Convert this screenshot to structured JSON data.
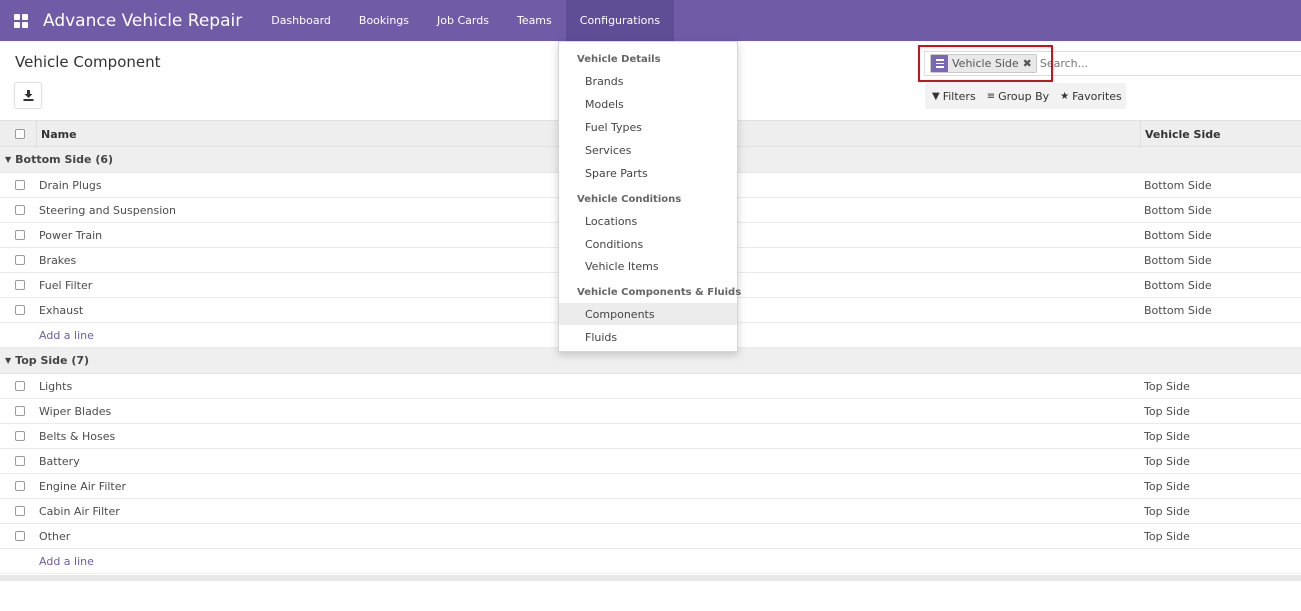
{
  "nav": {
    "app_title": "Advance Vehicle Repair",
    "menu": [
      "Dashboard",
      "Bookings",
      "Job Cards",
      "Teams",
      "Configurations"
    ]
  },
  "page": {
    "title": "Vehicle Component"
  },
  "search": {
    "facet_label": "Vehicle Side",
    "placeholder": "Search...",
    "filters_label": "Filters",
    "group_by_label": "Group By",
    "favorites_label": "Favorites"
  },
  "list": {
    "col_name": "Name",
    "col_side": "Vehicle Side",
    "add_line": "Add a line",
    "groups": [
      {
        "label": "Bottom Side (6)",
        "rows": [
          {
            "name": "Drain Plugs",
            "side": "Bottom Side"
          },
          {
            "name": "Steering and Suspension",
            "side": "Bottom Side"
          },
          {
            "name": "Power Train",
            "side": "Bottom Side"
          },
          {
            "name": "Brakes",
            "side": "Bottom Side"
          },
          {
            "name": "Fuel Filter",
            "side": "Bottom Side"
          },
          {
            "name": "Exhaust",
            "side": "Bottom Side"
          }
        ]
      },
      {
        "label": "Top Side (7)",
        "rows": [
          {
            "name": "Lights",
            "side": "Top Side"
          },
          {
            "name": "Wiper Blades",
            "side": "Top Side"
          },
          {
            "name": "Belts & Hoses",
            "side": "Top Side"
          },
          {
            "name": "Battery",
            "side": "Top Side"
          },
          {
            "name": "Engine Air Filter",
            "side": "Top Side"
          },
          {
            "name": "Cabin Air Filter",
            "side": "Top Side"
          },
          {
            "name": "Other",
            "side": "Top Side"
          }
        ]
      }
    ]
  },
  "dropdown": {
    "section_details": "Vehicle Details",
    "details_items": [
      "Brands",
      "Models",
      "Fuel Types",
      "Services",
      "Spare Parts"
    ],
    "section_conditions": "Vehicle Conditions",
    "conditions_items": [
      "Locations",
      "Conditions",
      "Vehicle Items"
    ],
    "section_components": "Vehicle Components & Fluids",
    "components_items": [
      "Components",
      "Fluids"
    ]
  },
  "colors": {
    "brand": "#6f5ba6",
    "highlight": "#c5141b"
  }
}
